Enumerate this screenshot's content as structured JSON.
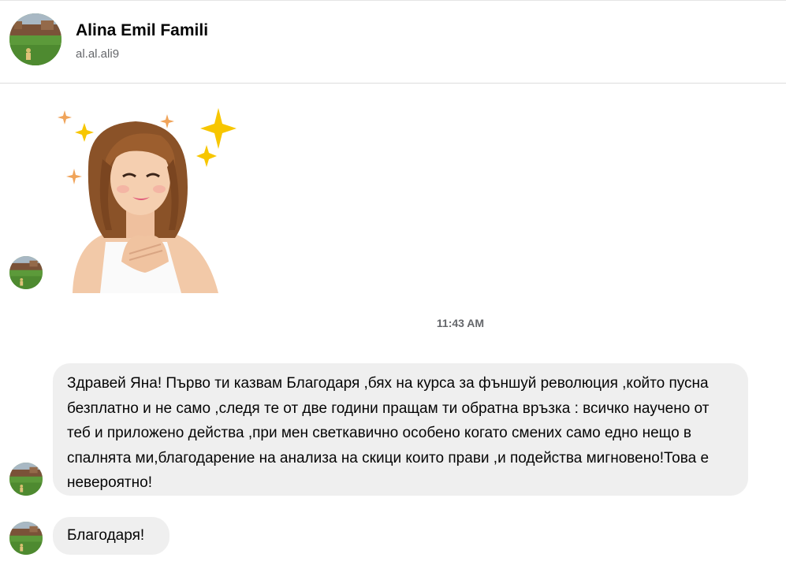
{
  "header": {
    "name": "Alina Emil Famili",
    "username": "al.al.ali9"
  },
  "conversation": {
    "timestamp": "11:43 AM",
    "messages": [
      {
        "type": "sticker",
        "sticker_icon": "avatar-heart-hands-sticker"
      },
      {
        "type": "text",
        "text": "Здравей Яна! Първо ти казвам Благодаря ,бях на курса за фъншуй революция ,който пусна безплатно и не само ,следя те от две години пращам ти обратна връзка : всичко научено от теб и приложено действа ,при мен светкавично особено когато смених само едно нещо в спалнята ми,благодарение на анализа на скици които прави ,и подейства мигновено!Това е невероятно!"
      },
      {
        "type": "text",
        "text": "Благодаря!"
      }
    ]
  },
  "colors": {
    "bubble_bg": "#efefef",
    "muted_text": "#65676b",
    "sparkle": "#f7c600",
    "sparkle_small": "#f0a45a"
  }
}
